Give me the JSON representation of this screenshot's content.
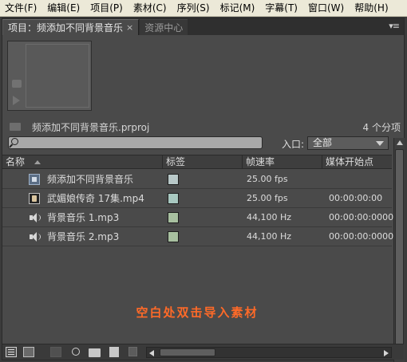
{
  "menubar": {
    "items": [
      {
        "label": "文件(F)"
      },
      {
        "label": "编辑(E)"
      },
      {
        "label": "项目(P)"
      },
      {
        "label": "素材(C)"
      },
      {
        "label": "序列(S)"
      },
      {
        "label": "标记(M)"
      },
      {
        "label": "字幕(T)"
      },
      {
        "label": "窗口(W)"
      },
      {
        "label": "帮助(H)"
      }
    ]
  },
  "tabs": {
    "project": "项目：频添加不同背景音乐",
    "close_glyph": "×",
    "resources": "资源中心",
    "panel_menu_glyph": "▾≡"
  },
  "project": {
    "file_name": "频添加不同背景音乐.prproj",
    "item_count": "4 个分项"
  },
  "search": {
    "value": "",
    "in_label": "入口:",
    "in_value": "全部"
  },
  "columns": {
    "name": "名称",
    "label": "标签",
    "frame_rate": "帧速率",
    "media_start": "媒体开始点"
  },
  "rows": [
    {
      "icon": "sequence-icon",
      "name": "频添加不同背景音乐",
      "label_color": "#b8c8c8",
      "fps": "25.00 fps",
      "start": ""
    },
    {
      "icon": "video-clip-icon",
      "name": "武媚娘传奇 17集.mp4",
      "label_color": "#a8c8c0",
      "fps": "25.00 fps",
      "start": "00:00:00:00"
    },
    {
      "icon": "audio-icon",
      "name": "背景音乐 1.mp3",
      "label_color": "#a8c0a0",
      "fps": "44,100 Hz",
      "start": "00:00:00:00000"
    },
    {
      "icon": "audio-icon",
      "name": "背景音乐 2.mp3",
      "label_color": "#a8c0a0",
      "fps": "44,100 Hz",
      "start": "00:00:00:00000"
    }
  ],
  "empty_hint": "空白处双击导入素材",
  "colors": {
    "hint": "#ff6a28",
    "panel_bg": "#4a4a4a"
  }
}
